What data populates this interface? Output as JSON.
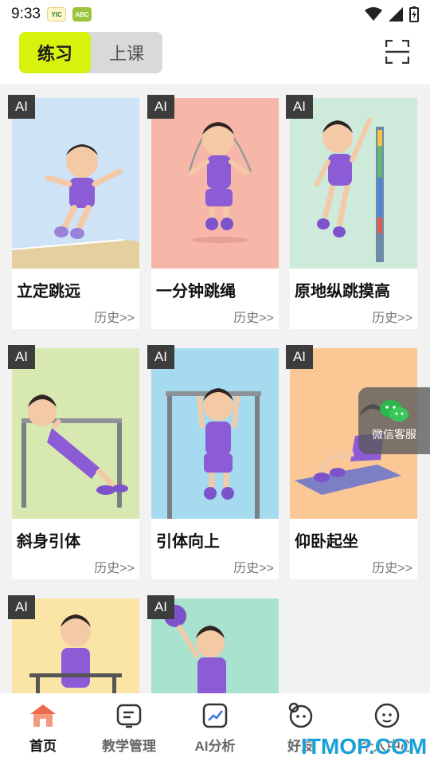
{
  "status_bar": {
    "time": "9:33",
    "badge_a": "YIC",
    "badge_b": "ABC"
  },
  "header": {
    "tab_active": "练习",
    "tab_idle": "上课"
  },
  "cards": [
    {
      "ai": "AI",
      "title": "立定跳远",
      "history": "历史>>",
      "bg": "#cfe3f7"
    },
    {
      "ai": "AI",
      "title": "一分钟跳绳",
      "history": "历史>>",
      "bg": "#f6b7a8"
    },
    {
      "ai": "AI",
      "title": "原地纵跳摸高",
      "history": "历史>>",
      "bg": "#cdeadb"
    },
    {
      "ai": "AI",
      "title": "斜身引体",
      "history": "历史>>",
      "bg": "#d7e8b0"
    },
    {
      "ai": "AI",
      "title": "引体向上",
      "history": "历史>>",
      "bg": "#a6dbef"
    },
    {
      "ai": "AI",
      "title": "仰卧起坐",
      "history": "历史>>",
      "bg": "#fbc795"
    },
    {
      "ai": "AI",
      "title": "",
      "history": "",
      "bg": "#fbe5a6"
    },
    {
      "ai": "AI",
      "title": "",
      "history": "",
      "bg": "#a9e2cf"
    }
  ],
  "float_service": {
    "label": "微信客服"
  },
  "tabbar": {
    "items": [
      {
        "label": "首页",
        "icon": "home-icon"
      },
      {
        "label": "教学管理",
        "icon": "teaching-icon"
      },
      {
        "label": "AI分析",
        "icon": "ai-analysis-icon"
      },
      {
        "label": "好友",
        "icon": "friends-icon"
      },
      {
        "label": "个人中心",
        "icon": "profile-icon"
      }
    ]
  },
  "watermark": "ITMOP.COM",
  "colors": {
    "accent": "#d7f20d",
    "purple": "#8b5cd6"
  }
}
